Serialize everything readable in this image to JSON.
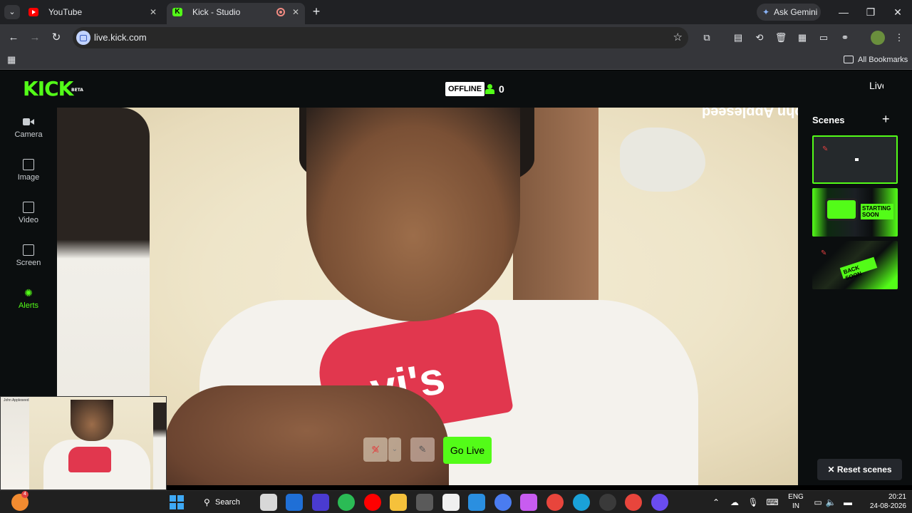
{
  "browser": {
    "tabs": [
      {
        "title": "YouTube",
        "active": false
      },
      {
        "title": "Kick - Studio",
        "active": true
      }
    ],
    "ask_gemini": "Ask Gemini",
    "url": "live.kick.com",
    "all_bookmarks": "All Bookmarks"
  },
  "kick": {
    "logo": "KICK",
    "logo_badge": "BETA",
    "status": "OFFLINE",
    "viewer_count": "0",
    "header_right_text": "Live",
    "sidebar": [
      {
        "label": "Camera",
        "icon": "camera-icon",
        "active": false
      },
      {
        "label": "Image",
        "icon": "image-icon",
        "active": false
      },
      {
        "label": "Video",
        "icon": "video-icon",
        "active": false
      },
      {
        "label": "Screen",
        "icon": "screen-cast-icon",
        "active": false
      },
      {
        "label": "Alerts",
        "icon": "alerts-icon",
        "active": true
      }
    ],
    "overlay_name": "John Appleseed",
    "shirt_logo": "vi's",
    "go_live": "Go Live",
    "scenes": {
      "title": "Scenes",
      "items": [
        {
          "label": "",
          "active": true
        },
        {
          "label": "STARTING SOON",
          "active": false
        },
        {
          "label": "BACK SOON",
          "active": false
        }
      ],
      "reset": "Reset scenes"
    },
    "pip_label": "John Appleseed"
  },
  "taskbar": {
    "search": "Search",
    "notification_count": "4",
    "lang_line1": "ENG",
    "lang_line2": "IN",
    "time": "20:21",
    "date": "24-08-2026"
  },
  "colors": {
    "kick_green": "#53fc18",
    "chrome_dark": "#202124",
    "panel_bg": "#0b0e0f"
  }
}
